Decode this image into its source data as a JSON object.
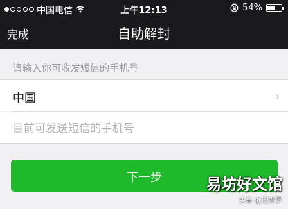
{
  "status_bar": {
    "carrier": "中国电信",
    "time": "上午12:13",
    "battery": "54%",
    "battery_level": 0.54,
    "signal_bars_filled": 1,
    "signal_bars_total": 5
  },
  "nav": {
    "done_label": "完成",
    "title": "自助解封"
  },
  "form": {
    "hint": "请输入你可收发短信的手机号",
    "country": "中国",
    "phone_placeholder": "目前可发送短信的手机号",
    "phone_value": ""
  },
  "next_button": "下一步",
  "watermark": {
    "logo_text": "易坊好文馆",
    "credit": "头条 @巴乔罗"
  },
  "colors": {
    "nav_bg": "#1a1a1c",
    "button_green": "#1fba2c",
    "page_bg": "#f1f1f3"
  }
}
